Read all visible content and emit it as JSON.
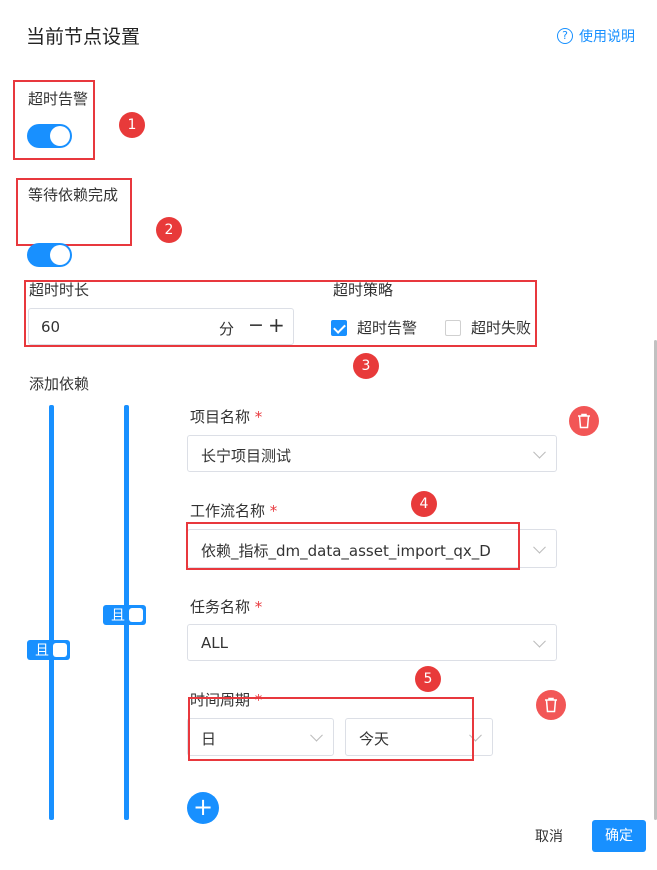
{
  "dialog": {
    "title": "当前节点设置",
    "help_label": "使用说明",
    "help_icon": "question-circle-icon"
  },
  "timeout_alert": {
    "label": "超时告警",
    "enabled": true
  },
  "wait_dependency": {
    "label": "等待依赖完成",
    "enabled": true
  },
  "timeout_duration": {
    "label": "超时时长",
    "value": "60",
    "unit": "分",
    "minus": "−",
    "plus": "+"
  },
  "timeout_strategy": {
    "label": "超时策略",
    "options": [
      {
        "label": "超时告警",
        "checked": true
      },
      {
        "label": "超时失败",
        "checked": false
      }
    ]
  },
  "dependencies": {
    "label": "添加依赖",
    "outer_relation": "且",
    "inner_relation": "且",
    "project": {
      "label": "项目名称",
      "required": "*",
      "value": "长宁项目测试"
    },
    "workflow": {
      "label": "工作流名称",
      "required": "*",
      "value": "依赖_指标_dm_data_asset_import_qx_D"
    },
    "task": {
      "label": "任务名称",
      "required": "*",
      "value": "ALL"
    },
    "period": {
      "label": "时间周期",
      "required": "*",
      "unit_value": "日",
      "day_value": "今天"
    }
  },
  "annotations": [
    "1",
    "2",
    "3",
    "4",
    "5"
  ],
  "footer": {
    "cancel_label": "取消",
    "confirm_label": "确定"
  },
  "colors": {
    "primary": "#1890ff",
    "danger": "#f25656",
    "annotation_red": "#e8383d"
  }
}
